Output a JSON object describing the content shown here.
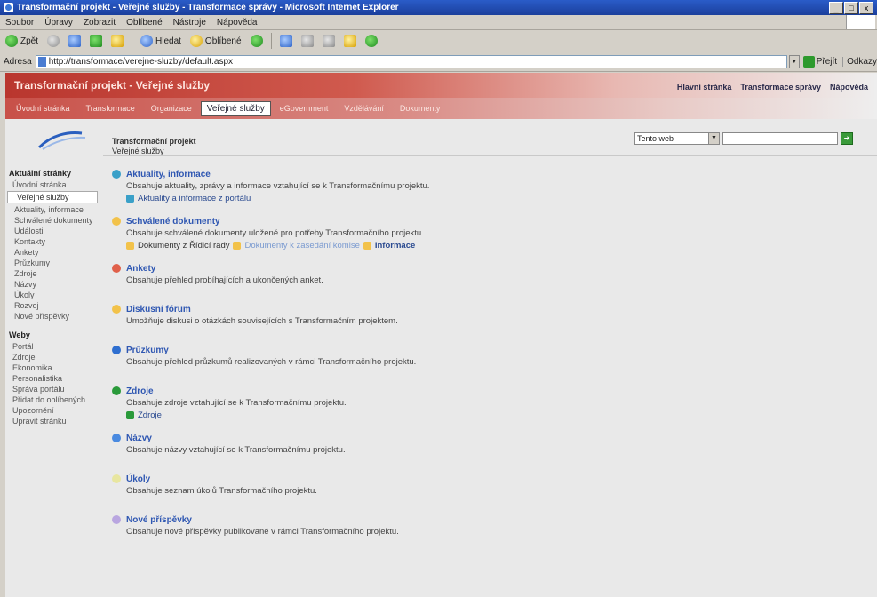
{
  "window": {
    "title": "Transformační projekt - Veřejné služby - Transformace správy - Microsoft Internet Explorer",
    "buttons": [
      "_",
      "□",
      "x"
    ]
  },
  "menu": [
    "Soubor",
    "Úpravy",
    "Zobrazit",
    "Oblíbené",
    "Nástroje",
    "Nápověda"
  ],
  "toolbar": {
    "back": "Zpět",
    "search": "Hledat",
    "favorites": "Oblíbené"
  },
  "address": {
    "label": "Adresa",
    "url": "http://transformace/verejne-sluzby/default.aspx",
    "go": "Přejít",
    "links": "Odkazy"
  },
  "site": {
    "title": "Transformační projekt - Veřejné služby",
    "top_links": [
      "Hlavní stránka",
      "Transformace správy",
      "Nápověda"
    ]
  },
  "nav": {
    "tabs": [
      "Úvodní stránka",
      "Transformace",
      "Organizace",
      "Veřejné služby",
      "eGovernment",
      "Vzdělávání",
      "Dokumenty"
    ],
    "active": "Veřejné služby"
  },
  "crumb": {
    "line1": "Transformační projekt",
    "line2": "Veřejné služby"
  },
  "search": {
    "scope": "Tento web"
  },
  "sidebar": {
    "heading1": "Aktuální stránky",
    "items1": [
      "Úvodní stránka",
      "Veřejné služby",
      "Aktuality, informace",
      "Schválené dokumenty",
      "Události",
      "Kontakty",
      "Ankety",
      "Průzkumy",
      "Zdroje",
      "Názvy",
      "Úkoly",
      "Rozvoj",
      "Nové příspěvky"
    ],
    "active_item": "Veřejné služby",
    "heading2": "Weby",
    "items2": [
      "Portál",
      "Zdroje",
      "Ekonomika",
      "Personalistika",
      "Správa portálu",
      "Přidat do oblíbených",
      "Upozornění",
      "Upravit stránku"
    ]
  },
  "sections": [
    {
      "title": "Aktuality, informace",
      "desc": "Obsahuje aktuality, zprávy a informace vztahující se k Transformačnímu projektu.",
      "icon_color": "#3aa0c8",
      "subs": [
        {
          "text": "Aktuality a informace z portálu"
        }
      ]
    },
    {
      "title": "Schválené dokumenty",
      "desc": "Obsahuje schválené dokumenty uložené pro potřeby Transformačního projektu.",
      "icon_color": "#f2c24a",
      "subs": [
        {
          "text": "Dokumenty z Řídicí rady"
        },
        {
          "text": "Dokumenty k zasedání komise"
        },
        {
          "text": "Informace"
        }
      ]
    },
    {
      "title": "Ankety",
      "desc": "Obsahuje přehled probíhajících a ukončených anket.",
      "icon_color": "#e0604a",
      "subs": []
    },
    {
      "title": "Diskusní fórum",
      "desc": "Umožňuje diskusi o otázkách souvisejících s Transformačním projektem.",
      "icon_color": "#f2c24a",
      "subs": []
    },
    {
      "title": "Průzkumy",
      "desc": "Obsahuje přehled průzkumů realizovaných v rámci Transformačního projektu.",
      "icon_color": "#2f6fd0",
      "subs": []
    },
    {
      "title": "Zdroje",
      "desc": "Obsahuje zdroje vztahující se k Transformačnímu projektu.",
      "icon_color": "#2a9a3a",
      "subs": [
        {
          "text": "Zdroje"
        }
      ]
    },
    {
      "title": "Názvy",
      "desc": "Obsahuje názvy vztahující se k Transformačnímu projektu.",
      "icon_color": "#4a8ae0",
      "subs": []
    },
    {
      "title": "Úkoly",
      "desc": "Obsahuje seznam úkolů Transformačního projektu.",
      "icon_color": "#e8e6a0",
      "subs": []
    },
    {
      "title": "Nové příspěvky",
      "desc": "Obsahuje nové příspěvky publikované v rámci Transformačního projektu.",
      "icon_color": "#b9a6e0",
      "subs": []
    }
  ]
}
